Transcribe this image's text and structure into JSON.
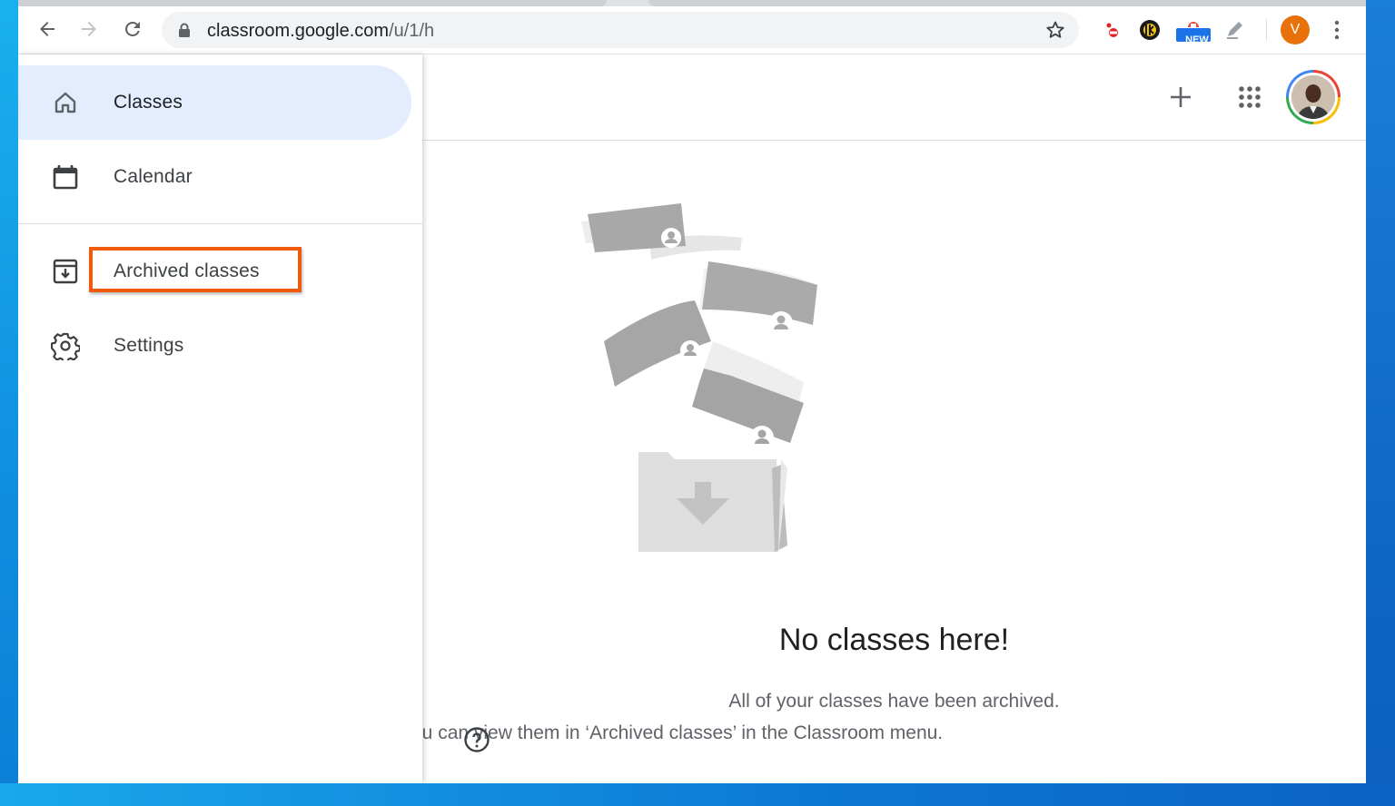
{
  "browser": {
    "url_host": "classroom.google.com",
    "url_path": "/u/1/h",
    "profile_initial": "V",
    "extension_badge": "NEW"
  },
  "drawer": {
    "items": [
      {
        "label": "Classes",
        "icon": "home-icon",
        "active": true
      },
      {
        "label": "Calendar",
        "icon": "calendar-icon",
        "active": false
      },
      {
        "label": "Archived classes",
        "icon": "archive-icon",
        "active": false,
        "highlighted": true
      },
      {
        "label": "Settings",
        "icon": "gear-icon",
        "active": false
      }
    ]
  },
  "header": {
    "add_icon": "plus-icon",
    "apps_icon": "apps-grid-icon",
    "account_icon": "avatar"
  },
  "main": {
    "empty_title": "No classes here!",
    "empty_line1": "All of your classes have been archived.",
    "empty_line2": "ou can view them in ‘Archived classes’ in the Classroom menu."
  },
  "colors": {
    "accent_highlight": "#f05a0c",
    "active_nav_bg": "#e3edfd",
    "profile_orange": "#e8710a"
  }
}
